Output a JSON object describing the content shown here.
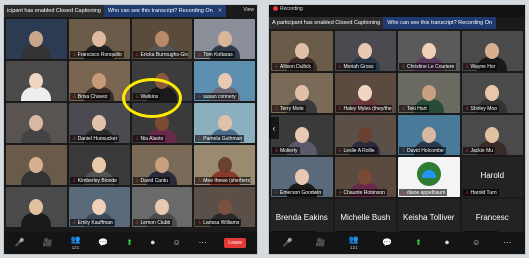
{
  "left": {
    "banner_text": "icipant has enabled Closed Captioning",
    "who_text": "Who can see this transcript? Recording On",
    "view_label": "View",
    "tiles": [
      {
        "name": "",
        "kind": "person",
        "bg": "#2c3b52",
        "skin": "#c9a58a",
        "shirt": "#333"
      },
      {
        "name": "Francisco Ronquillo",
        "kind": "person",
        "bg": "#6a5a48",
        "skin": "#e0b9a0",
        "shirt": "#202020"
      },
      {
        "name": "Ericka Burroughs-Girard",
        "kind": "person",
        "bg": "#5a4c3a",
        "skin": "#b88a6a",
        "shirt": "#555"
      },
      {
        "name": "Tom Kottaras",
        "kind": "person",
        "bg": "#8a8f99",
        "skin": "#d9b59a",
        "shirt": "#2f3a4a"
      },
      {
        "name": "",
        "kind": "person",
        "bg": "#4a4a4a",
        "skin": "#f0d6c0",
        "shirt": "#eee"
      },
      {
        "name": "Brisa Chavez",
        "kind": "person",
        "bg": "#7a6650",
        "skin": "#c89b78",
        "shirt": "#3a2a2a"
      },
      {
        "name": "Watkins",
        "kind": "person",
        "bg": "#3c3c3c",
        "skin": "#8a5a3c",
        "shirt": "#1a1a1a"
      },
      {
        "name": "susan connery",
        "kind": "person",
        "bg": "#5d8fb0",
        "skin": "#e8c8b0",
        "shirt": "#6a6a7a"
      },
      {
        "name": "",
        "kind": "person",
        "bg": "#5a5450",
        "skin": "#d8b8a0",
        "shirt": "#444"
      },
      {
        "name": "Daniel Hunsucker",
        "kind": "person",
        "bg": "#4a4a50",
        "skin": "#e2c2a8",
        "shirt": "#2a2a2a"
      },
      {
        "name": "Nia Alaoto",
        "kind": "person",
        "bg": "#3a3a3a",
        "skin": "#7a4a32",
        "shirt": "#6a2a4a"
      },
      {
        "name": "Pamela Guthman",
        "kind": "person",
        "bg": "#8ab0c0",
        "skin": "#e0c0a8",
        "shirt": "#4a6a8a"
      },
      {
        "name": "",
        "kind": "person",
        "bg": "#6a5a4a",
        "skin": "#d8b090",
        "shirt": "#333"
      },
      {
        "name": "Kimberley Blonde",
        "kind": "person",
        "bg": "#3a3a3a",
        "skin": "#e8c8a8",
        "shirt": "#555"
      },
      {
        "name": "David Cantu",
        "kind": "person",
        "bg": "#7a6a58",
        "skin": "#c8a080",
        "shirt": "#2a2a3a"
      },
      {
        "name": "Mee Ihewe (she/hers)",
        "kind": "person",
        "bg": "#9a8a70",
        "skin": "#6a4030",
        "shirt": "#8a3a2a"
      },
      {
        "name": "",
        "kind": "person",
        "bg": "#4a4a4a",
        "skin": "#e0c0a0",
        "shirt": "#1a1a1a"
      },
      {
        "name": "Emily Kauffman",
        "kind": "person",
        "bg": "#5a6a7a",
        "skin": "#f0d0b8",
        "shirt": "#3a4a5a"
      },
      {
        "name": "Lemon Clubb",
        "kind": "person",
        "bg": "#6a6a6a",
        "skin": "#e8c8b0",
        "shirt": "#4a4a4a"
      },
      {
        "name": "Larissa Williams",
        "kind": "person",
        "bg": "#5a5048",
        "skin": "#7a5040",
        "shirt": "#2a2a2a"
      }
    ],
    "toolbar": [
      {
        "icon": "🎤",
        "label": "",
        "green": false
      },
      {
        "icon": "🎥",
        "label": "",
        "green": false
      },
      {
        "icon": "👥",
        "label": "121",
        "green": false
      },
      {
        "icon": "💬",
        "label": "",
        "green": false
      },
      {
        "icon": "⬆",
        "label": "",
        "green": true
      },
      {
        "icon": "⏺",
        "label": "",
        "green": false
      },
      {
        "icon": "☺",
        "label": "",
        "green": false
      },
      {
        "icon": "⋯",
        "label": "",
        "green": false
      }
    ],
    "leave": "Leave"
  },
  "right": {
    "rec_text": "Recording",
    "banner_text": "A participant has enabled Closed Captioning",
    "who_text": "Who can see this transcript? Recording On",
    "tiles": [
      {
        "name": "Allison Dullick",
        "kind": "person",
        "bg": "#6a5a48",
        "skin": "#e0c0a8",
        "shirt": "#3a2a2a"
      },
      {
        "name": "Moriah Gross",
        "kind": "person",
        "bg": "#4a4a50",
        "skin": "#e8c8b0",
        "shirt": "#2a3a4a"
      },
      {
        "name": "Christine Le Couriere",
        "kind": "person",
        "bg": "#5a5a5a",
        "skin": "#f0d0b8",
        "shirt": "#5a3a5a"
      },
      {
        "name": "Wayne Hor",
        "kind": "person",
        "bg": "#4a4a4a",
        "skin": "#d8b090",
        "shirt": "#1a1a1a"
      },
      {
        "name": "Terry Mote",
        "kind": "person",
        "bg": "#7a6a58",
        "skin": "#e0c0a8",
        "shirt": "#3a3a3a"
      },
      {
        "name": "Haley Myles (they/them)",
        "kind": "person",
        "bg": "#5a4a40",
        "skin": "#f0d6c0",
        "shirt": "#6a3a3a"
      },
      {
        "name": "Teki Hart",
        "kind": "person",
        "bg": "#6a6a60",
        "skin": "#c8a080",
        "shirt": "#2a4a3a"
      },
      {
        "name": "Shirley Moo",
        "kind": "person",
        "bg": "#4a4a4a",
        "skin": "#e8c8a8",
        "shirt": "#333"
      },
      {
        "name": "Molierty",
        "kind": "person",
        "bg": "#3a3a3a",
        "skin": "#e8c8b0",
        "shirt": "#5a5a6a"
      },
      {
        "name": "Leslie A Rollie",
        "kind": "person",
        "bg": "#5a5048",
        "skin": "#6a4030",
        "shirt": "#2a2a3a"
      },
      {
        "name": "David Holcombe",
        "kind": "person",
        "bg": "#4a7a9a",
        "skin": "#d8b8a0",
        "shirt": "#2a3a4a"
      },
      {
        "name": "Jackie Mu",
        "kind": "person",
        "bg": "#4a4a4a",
        "skin": "#e0c0a0",
        "shirt": "#3a2a2a"
      },
      {
        "name": "Emerson Goodwin",
        "kind": "person",
        "bg": "#5a6a7a",
        "skin": "#e8c8b0",
        "shirt": "#1a1a1a"
      },
      {
        "name": "Chaunte Robinson",
        "kind": "person",
        "bg": "#5a4a40",
        "skin": "#7a4a32",
        "shirt": "#6a2a4a"
      },
      {
        "name": "diane appelbaum",
        "kind": "logo",
        "big": ""
      },
      {
        "name": "Harold Turn",
        "kind": "blank",
        "big": "Harold"
      },
      {
        "name": "Brenda Eakins",
        "kind": "blank",
        "big": "Brenda Eakins"
      },
      {
        "name": "Michelle Bush",
        "kind": "blank",
        "big": "Michelle Bush"
      },
      {
        "name": "Keisha Tolliver",
        "kind": "blank",
        "big": "Keisha Tolliver"
      },
      {
        "name": "Frances Ca",
        "kind": "blank",
        "big": "Francesc"
      }
    ],
    "toolbar": [
      {
        "icon": "🎤",
        "label": "",
        "green": false
      },
      {
        "icon": "🎥",
        "label": "",
        "green": false
      },
      {
        "icon": "👥",
        "label": "121",
        "green": false
      },
      {
        "icon": "💬",
        "label": "",
        "green": false
      },
      {
        "icon": "⬆",
        "label": "",
        "green": true
      },
      {
        "icon": "⏺",
        "label": "",
        "green": false
      },
      {
        "icon": "☺",
        "label": "",
        "green": false
      },
      {
        "icon": "⋯",
        "label": "",
        "green": false
      }
    ]
  }
}
